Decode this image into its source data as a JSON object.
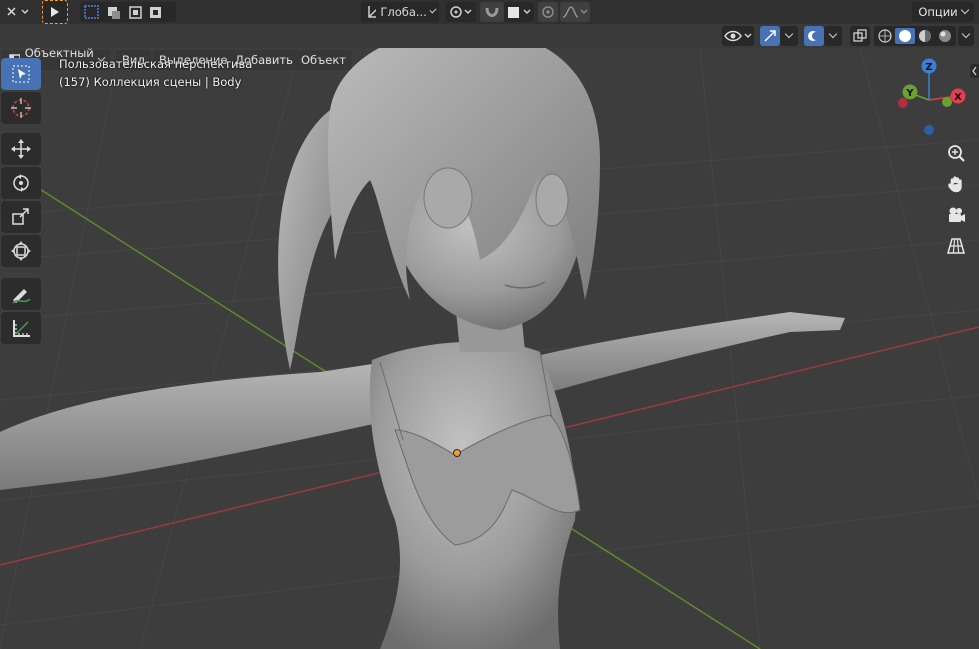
{
  "header": {
    "transform_orientation": "Глоба...",
    "options_label": "Опции"
  },
  "menu": {
    "mode": "Объектный ...",
    "view": "Вид",
    "select": "Выделение",
    "add": "Добавить",
    "object": "Объект"
  },
  "viewport": {
    "perspective": "Пользовательская перспектива",
    "collection": "(157) Коллекция сцены | Body"
  },
  "gizmo": {
    "x_label": "X",
    "y_label": "Y",
    "z_label": "Z",
    "x_color": "#e0404f",
    "y_color": "#6ca030",
    "z_color": "#3d7fd6"
  },
  "tools": [
    {
      "name": "select-box-icon"
    },
    {
      "name": "cursor-icon"
    },
    {
      "name": "move-icon"
    },
    {
      "name": "rotate-icon"
    },
    {
      "name": "scale-icon"
    },
    {
      "name": "transform-icon"
    },
    {
      "name": "annotate-icon"
    },
    {
      "name": "measure-icon"
    }
  ],
  "colors": {
    "accent": "#4772b3",
    "x_axis_line": "#9b3a3f",
    "y_axis_line": "#5f8a2b",
    "origin": "#f29c38"
  }
}
